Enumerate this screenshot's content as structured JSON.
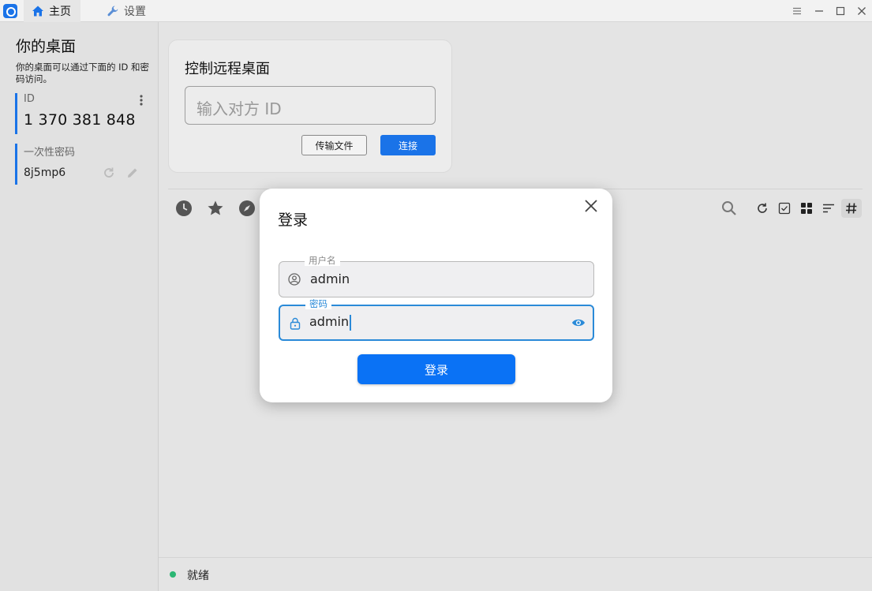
{
  "titlebar": {
    "tabs": [
      {
        "label": "主页",
        "icon": "home-icon"
      },
      {
        "label": "设置",
        "icon": "wrench-icon"
      }
    ],
    "controls": [
      "menu-icon",
      "minimize-icon",
      "maximize-icon",
      "close-icon"
    ]
  },
  "left_panel": {
    "title": "你的桌面",
    "description": "你的桌面可以通过下面的 ID 和密码访问。",
    "id_label": "ID",
    "id_value": "1 370 381 848",
    "password_label": "一次性密码",
    "password_value": "8j5mp6"
  },
  "remote": {
    "title": "控制远程桌面",
    "id_placeholder": "输入对方 ID",
    "transfer_label": "传输文件",
    "connect_label": "连接"
  },
  "dialog": {
    "title": "登录",
    "username_label": "用户名",
    "username_value": "admin",
    "password_label": "密码",
    "password_value": "admin",
    "login_label": "登录"
  },
  "status": {
    "text": "就绪",
    "color": "#2bb673"
  },
  "colors": {
    "accent": "#1a73e8",
    "login_button": "#0a72f5",
    "focus": "#2a8ad8"
  }
}
